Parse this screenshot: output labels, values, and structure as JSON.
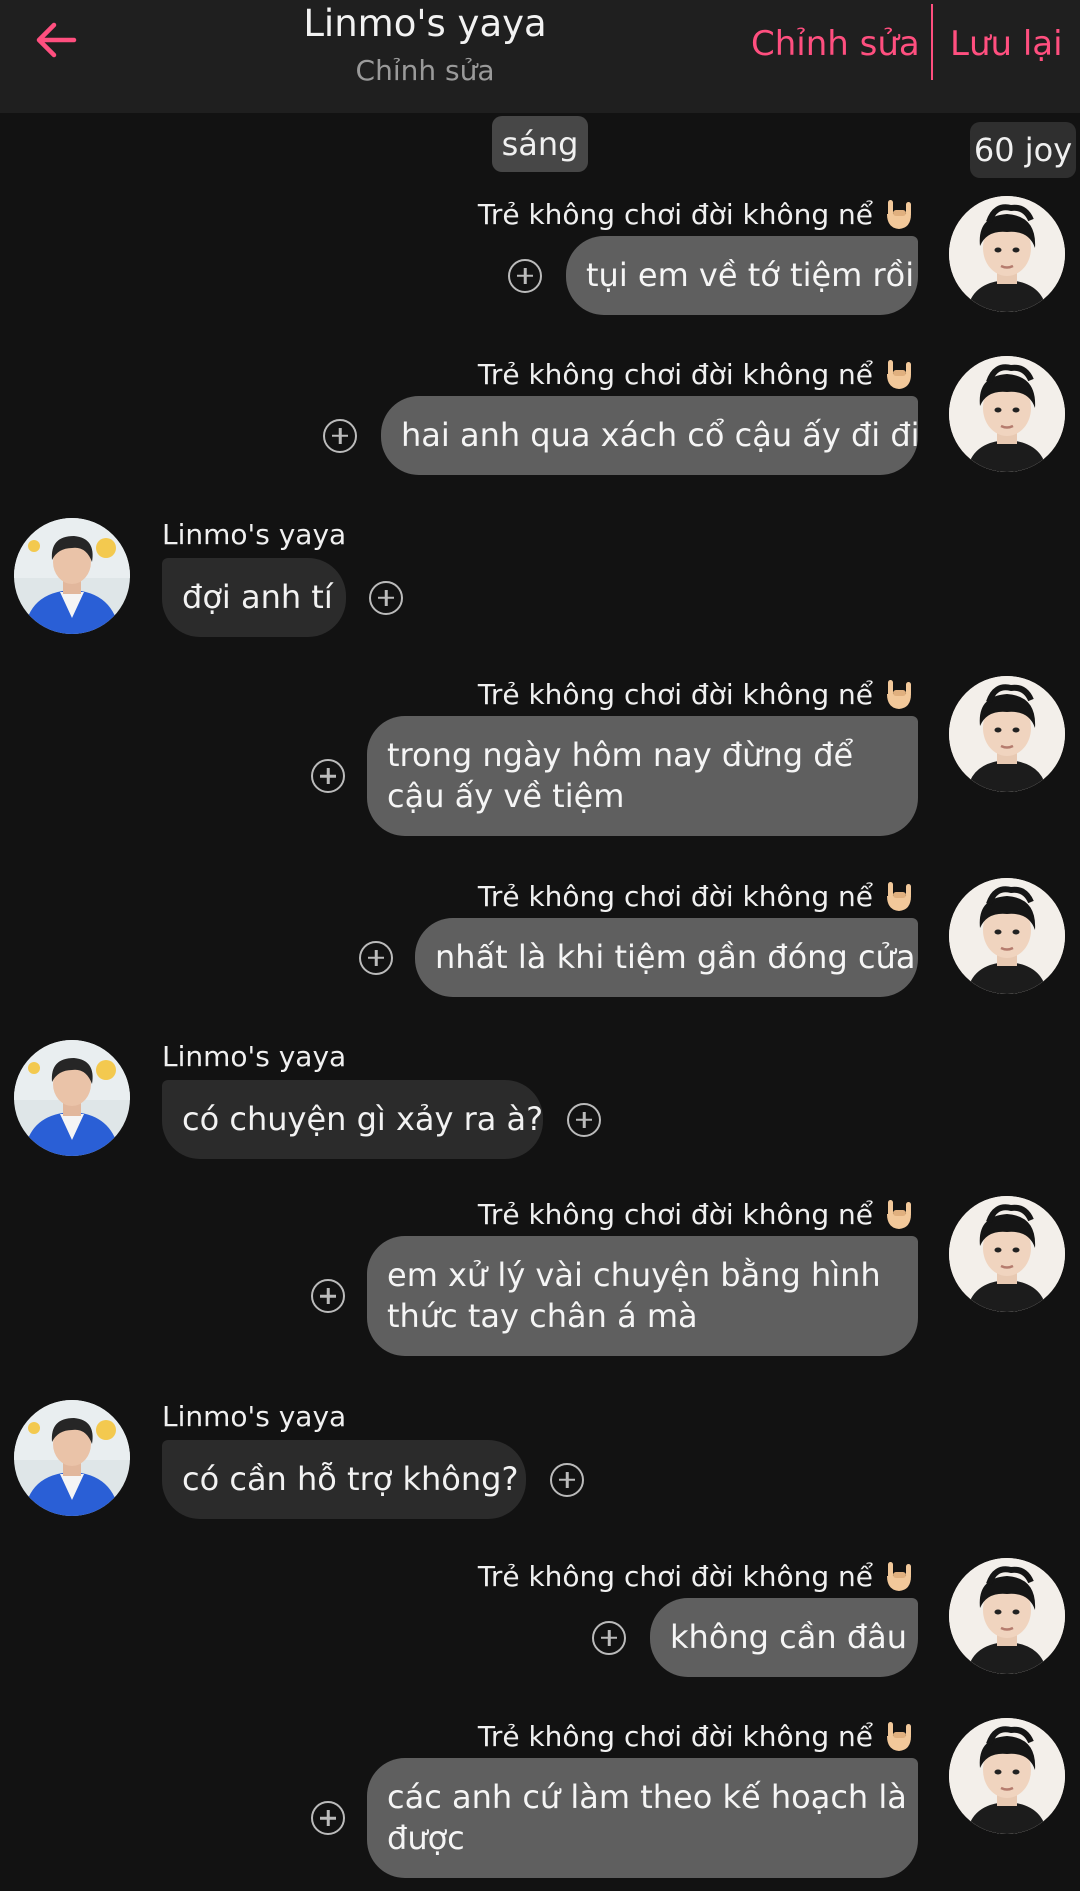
{
  "header": {
    "title": "Linmo's yaya",
    "subtitle": "Chỉnh sửa",
    "edit_label": "Chỉnh sửa",
    "save_label": "Lưu lại",
    "accent_color": "#ff4f7f"
  },
  "time_label": "sáng",
  "joy_label": "60 joy",
  "users": {
    "me": "Trẻ không chơi đời không nể",
    "other": "Linmo's yaya"
  },
  "messages": [
    {
      "side": "right",
      "sender": "Trẻ không chơi đời không nể",
      "lines": [
        "tụi em về tớ tiệm rồi"
      ]
    },
    {
      "side": "right",
      "sender": "Trẻ không chơi đời không nể",
      "lines": [
        "hai anh qua xách cổ cậu ấy đi đi"
      ]
    },
    {
      "side": "left",
      "sender": "Linmo's yaya",
      "lines": [
        "đợi anh tí"
      ]
    },
    {
      "side": "right",
      "sender": "Trẻ không chơi đời không nể",
      "lines": [
        "trong ngày hôm nay đừng để",
        "cậu ấy về tiệm"
      ]
    },
    {
      "side": "right",
      "sender": "Trẻ không chơi đời không nể",
      "lines": [
        "nhất là khi tiệm gần đóng cửa"
      ]
    },
    {
      "side": "left",
      "sender": "Linmo's yaya",
      "lines": [
        "có chuyện gì xảy ra à?"
      ]
    },
    {
      "side": "right",
      "sender": "Trẻ không chơi đời không nể",
      "lines": [
        "em xử lý vài chuyện bằng hình",
        "thức tay chân á mà"
      ]
    },
    {
      "side": "left",
      "sender": "Linmo's yaya",
      "lines": [
        "có cần hỗ trợ không?"
      ]
    },
    {
      "side": "right",
      "sender": "Trẻ không chơi đời không nể",
      "lines": [
        "không cần đâu"
      ]
    },
    {
      "side": "right",
      "sender": "Trẻ không chơi đời không nể",
      "lines": [
        "các anh cứ làm theo kế hoạch là",
        "được"
      ]
    }
  ]
}
